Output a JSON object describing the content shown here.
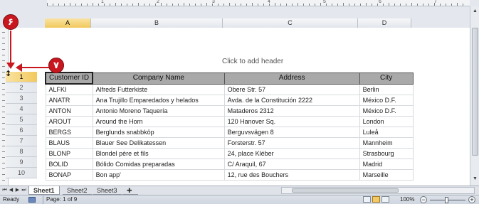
{
  "ruler": {
    "numbers": [
      "1",
      "2",
      "3",
      "4",
      "5",
      "6",
      "7"
    ]
  },
  "columns": [
    "A",
    "B",
    "C",
    "D"
  ],
  "header_hint": "Click to add header",
  "rows": [
    "1",
    "2",
    "3",
    "4",
    "5",
    "6",
    "7",
    "8",
    "9",
    "10"
  ],
  "table": {
    "headers": [
      "Customer ID",
      "Company Name",
      "Address",
      "City"
    ],
    "records": [
      [
        "ALFKI",
        "Alfreds Futterkiste",
        "Obere Str. 57",
        "Berlin"
      ],
      [
        "ANATR",
        "Ana Trujillo Emparedados y helados",
        "Avda. de la Constitución 2222",
        "México D.F."
      ],
      [
        "ANTON",
        "Antonio Moreno Taquería",
        "Mataderos  2312",
        "México D.F."
      ],
      [
        "AROUT",
        "Around the Horn",
        "120 Hanover Sq.",
        "London"
      ],
      [
        "BERGS",
        "Berglunds snabbköp",
        "Berguvsvägen  8",
        "Luleå"
      ],
      [
        "BLAUS",
        "Blauer See Delikatessen",
        "Forsterstr. 57",
        "Mannheim"
      ],
      [
        "BLONP",
        "Blondel père et fils",
        "24, place Kléber",
        "Strasbourg"
      ],
      [
        "BOLID",
        "Bólido Comidas preparadas",
        "C/ Araquil, 67",
        "Madrid"
      ],
      [
        "BONAP",
        "Bon app'",
        "12, rue des Bouchers",
        "Marseille"
      ]
    ]
  },
  "callouts": {
    "six": "۶",
    "seven": "۷"
  },
  "sheets": [
    "Sheet1",
    "Sheet2",
    "Sheet3"
  ],
  "status": {
    "ready": "Ready",
    "page": "Page: 1 of 9",
    "zoom": "100%"
  },
  "colors": {
    "callout": "#c8171e",
    "selected_header": "#f2c95e",
    "table_header": "#a9a9a9"
  }
}
